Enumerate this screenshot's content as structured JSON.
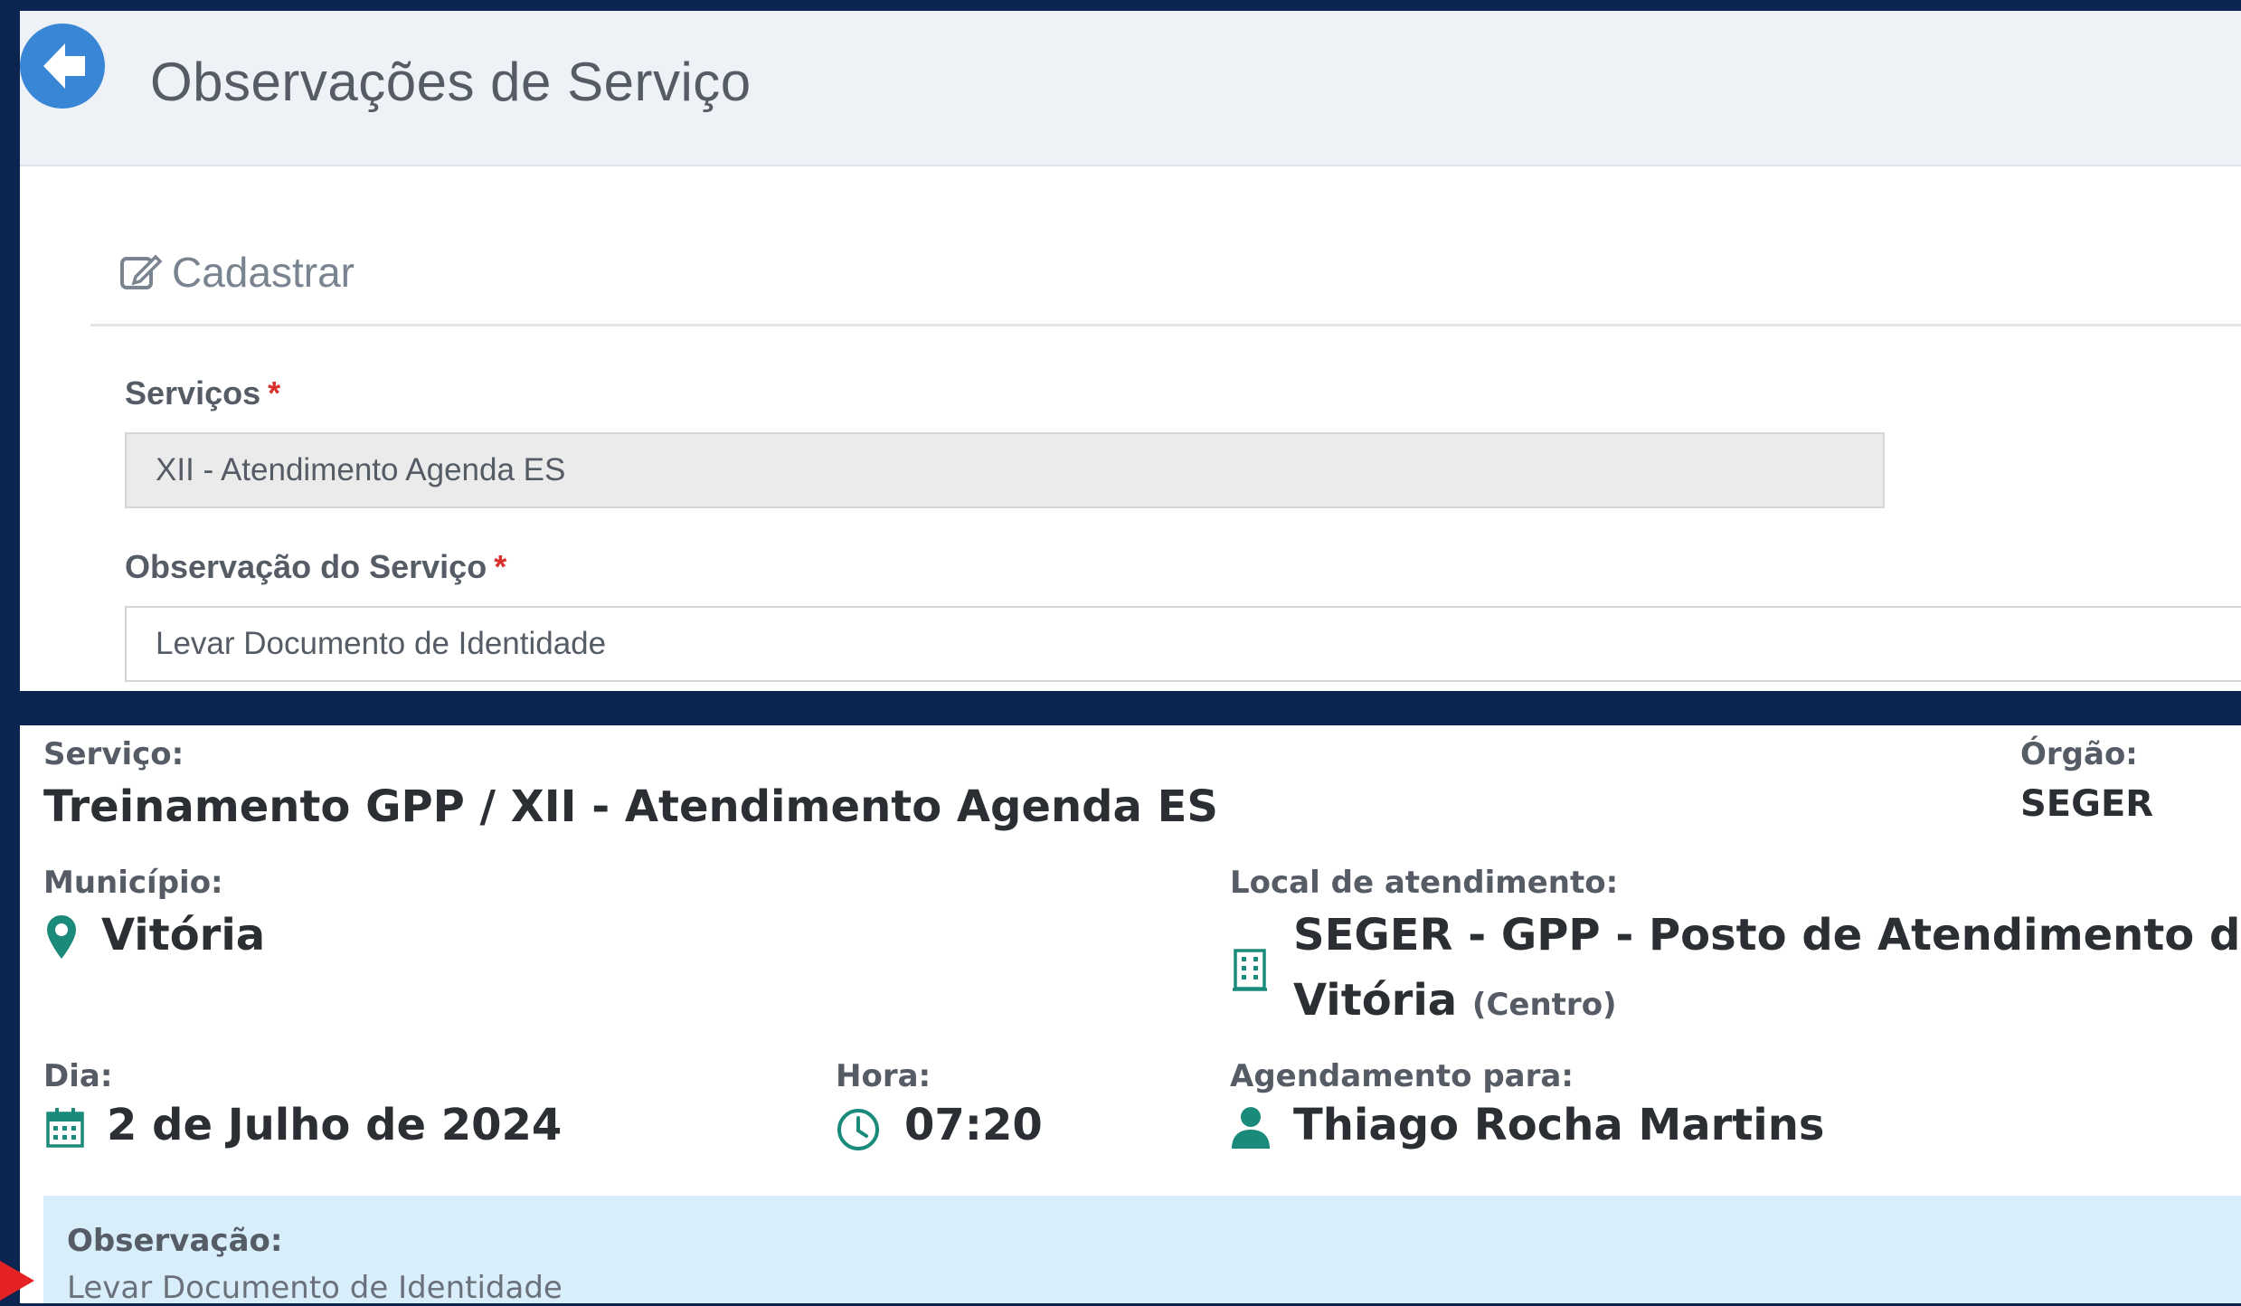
{
  "top": {
    "title": "Observações de Serviço",
    "section_title": "Cadastrar",
    "servicos": {
      "label": "Serviços",
      "required_mark": "*",
      "value": "XII - Atendimento Agenda ES"
    },
    "observacao": {
      "label": "Observação do Serviço",
      "required_mark": "*",
      "value": "Levar Documento de Identidade"
    }
  },
  "details": {
    "servico_label": "Serviço:",
    "servico_value": "Treinamento GPP / XII - Atendimento Agenda ES",
    "orgao_label": "Órgão:",
    "orgao_value": "SEGER",
    "municipio_label": "Município:",
    "municipio_value": "Vitória",
    "local_label": "Local de atendimento:",
    "local_value_line1": "SEGER - GPP - Posto de Atendimento de",
    "local_value_line2": "Vitória",
    "local_suffix": "(Centro)",
    "dia_label": "Dia:",
    "dia_value": "2 de Julho de 2024",
    "hora_label": "Hora:",
    "hora_value": "07:20",
    "agendamento_label": "Agendamento para:",
    "agendamento_value": "Thiago Rocha Martins",
    "observacao_label": "Observação:",
    "observacao_value": "Levar Documento de Identidade"
  },
  "colors": {
    "background": "#0b2450",
    "accent_blue": "#3a86d6",
    "teal_icon": "#1a8a7a",
    "required_red": "#d9302c",
    "observation_bg": "#d8eefb",
    "arrow_red": "#e42226"
  },
  "icons": {
    "back": "arrow-left-circle-icon",
    "edit": "edit-square-icon",
    "location": "map-marker-icon",
    "building": "building-icon",
    "calendar": "calendar-icon",
    "clock": "clock-icon",
    "user": "user-icon"
  }
}
